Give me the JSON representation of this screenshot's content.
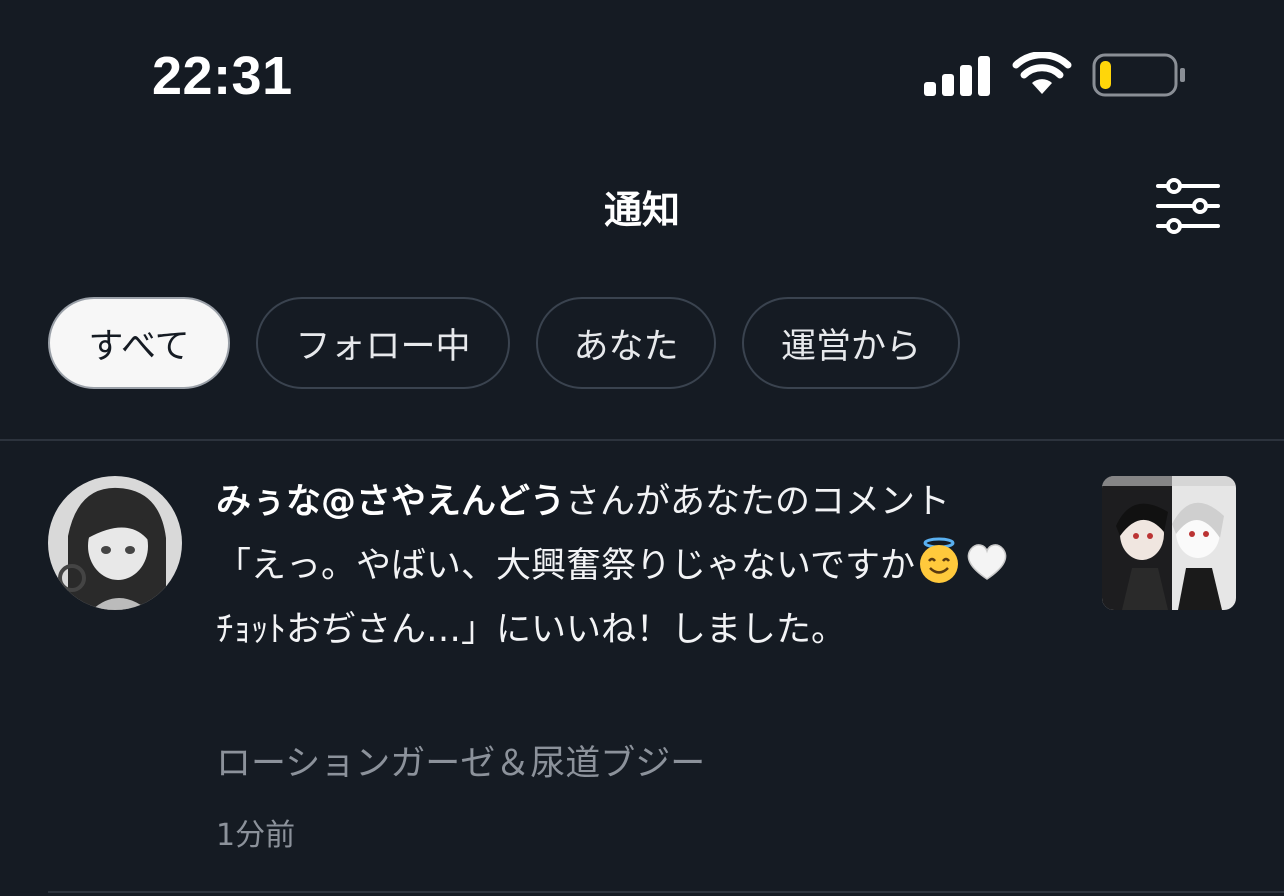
{
  "status_bar": {
    "time": "22:31",
    "signal_icon": "cellular-signal-icon",
    "wifi_icon": "wifi-icon",
    "battery_icon": "battery-low-icon",
    "battery_level": 0.15,
    "battery_color": "#ffd60a"
  },
  "header": {
    "title": "通知",
    "filter_icon": "sliders-icon"
  },
  "tabs": [
    {
      "label": "すべて",
      "active": true
    },
    {
      "label": "フォロー中",
      "active": false
    },
    {
      "label": "あなた",
      "active": false
    },
    {
      "label": "運営から",
      "active": false
    }
  ],
  "notifications": [
    {
      "user_name": "みぅな@さやえんどう",
      "message_part1": "さんがあなたのコメント「えっ。やばい、大興奮祭りじゃないですか",
      "emojis": [
        "smiling-face-with-halo",
        "white-heart"
      ],
      "message_part2": "ﾁｮｯﾄおぢさん…」にいいね！しました。",
      "post_title": "ローションガーゼ＆尿道ブジー",
      "timestamp": "1分前"
    }
  ],
  "colors": {
    "background": "#151b23",
    "tab_border": "#3a434f",
    "tab_active_bg": "#f7f7f7",
    "muted_text": "#8c929b",
    "divider": "#2c333d"
  }
}
